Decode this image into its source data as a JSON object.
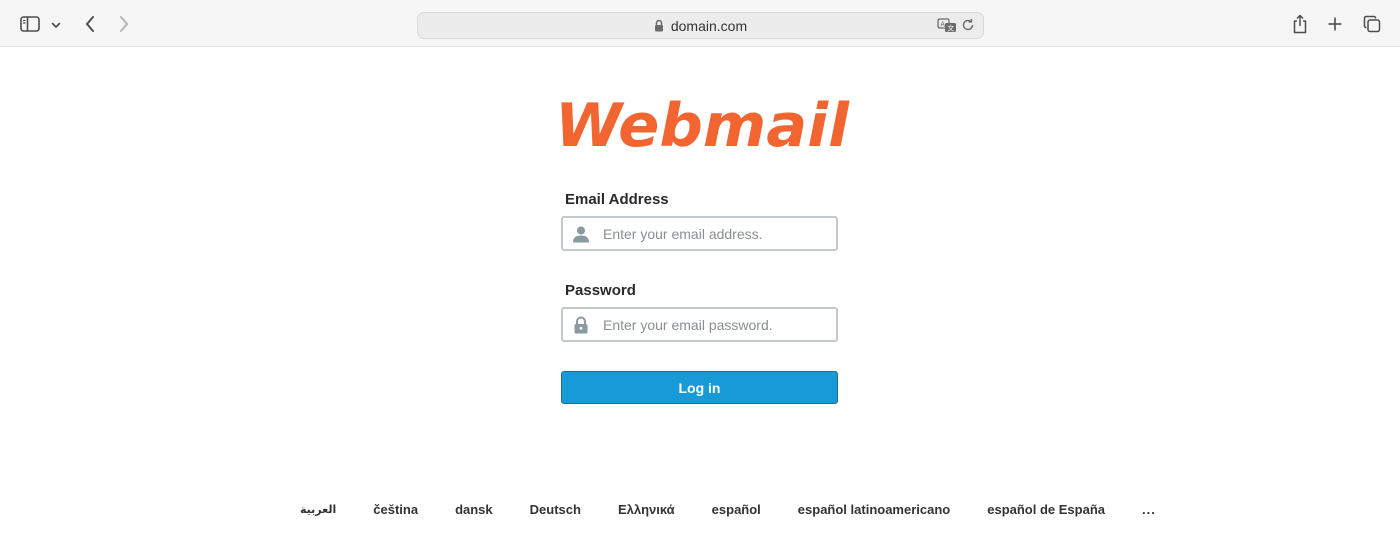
{
  "browser": {
    "url": "domain.com"
  },
  "brand": {
    "logo_text": "Webmail",
    "logo_color": "#f26430"
  },
  "form": {
    "email_label": "Email Address",
    "email_placeholder": "Enter your email address.",
    "email_value": "",
    "password_label": "Password",
    "password_placeholder": "Enter your email password.",
    "password_value": "",
    "login_label": "Log in",
    "accent_color": "#179bd7"
  },
  "languages": {
    "items": [
      "العربية",
      "čeština",
      "dansk",
      "Deutsch",
      "Ελληνικά",
      "español",
      "español latinoamericano",
      "español de España"
    ],
    "more_label": "..."
  },
  "icons": {
    "email_field": "user-icon",
    "password_field": "lock-icon"
  }
}
